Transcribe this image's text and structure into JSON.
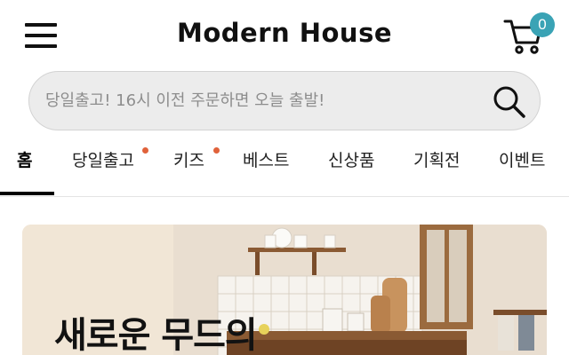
{
  "header": {
    "logo_text": "Modern House",
    "cart_count": "0"
  },
  "search": {
    "placeholder": "당일출고! 16시 이전 주문하면 오늘 출발!"
  },
  "tabs": [
    {
      "label": "홈",
      "active": true,
      "new_dot": false
    },
    {
      "label": "당일출고",
      "active": false,
      "new_dot": true
    },
    {
      "label": "키즈",
      "active": false,
      "new_dot": true
    },
    {
      "label": "베스트",
      "active": false,
      "new_dot": false
    },
    {
      "label": "신상품",
      "active": false,
      "new_dot": false
    },
    {
      "label": "기획전",
      "active": false,
      "new_dot": false
    },
    {
      "label": "이벤트",
      "active": false,
      "new_dot": false
    }
  ],
  "banner": {
    "title": "새로운 무드의"
  },
  "colors": {
    "badge": "#3aa3b5",
    "new_dot": "#e0623a",
    "search_bg": "#ececec"
  },
  "icons": {
    "menu": "hamburger-icon",
    "cart": "cart-icon",
    "search": "search-icon"
  }
}
